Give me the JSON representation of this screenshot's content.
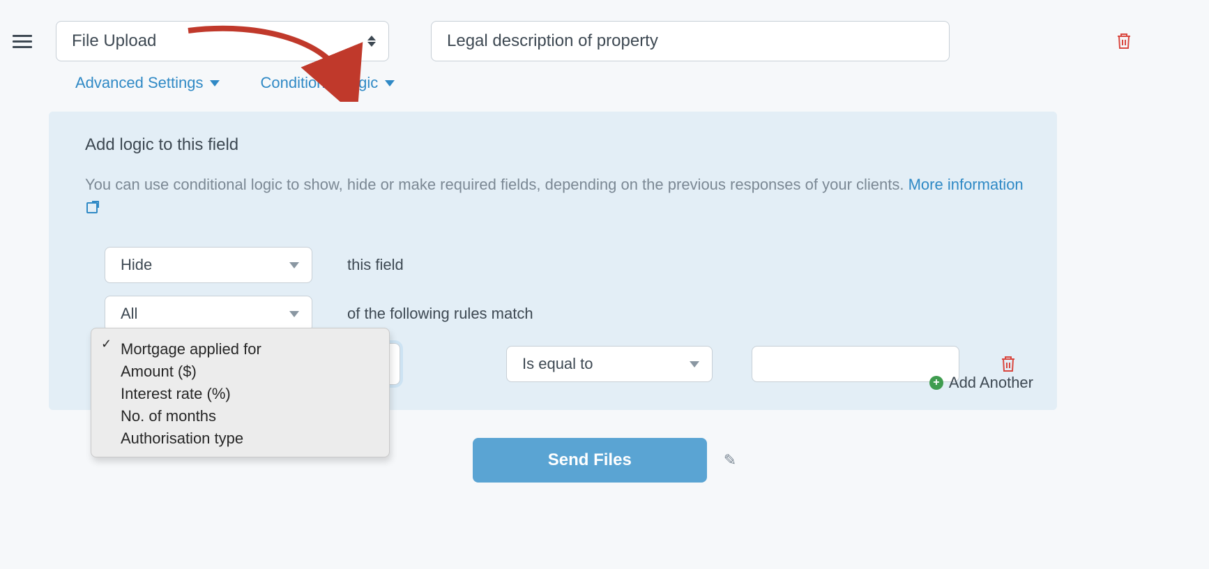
{
  "top": {
    "field_type": "File Upload",
    "field_label": "Legal description of property"
  },
  "tabs": {
    "advanced": "Advanced Settings",
    "conditional": "Conditional Logic"
  },
  "panel": {
    "heading": "Add logic to this field",
    "description": "You can use conditional logic to show, hide or make required fields, depending on the previous responses of your clients. ",
    "more_info_label": "More information",
    "action_select": "Hide",
    "action_suffix": "this field",
    "quantifier_select": "All",
    "quantifier_suffix": "of the following rules match",
    "rule_operator": "Is equal to",
    "rule_value": "",
    "add_another": "Add Another"
  },
  "field_options": [
    "",
    "Mortgage applied for",
    "Amount ($)",
    "Interest rate (%)",
    "No. of months",
    "Authorisation type"
  ],
  "submit_label": "Send Files",
  "colors": {
    "accent": "#2f89c5",
    "danger": "#d9463e",
    "success": "#3f9c4f",
    "button": "#5aa4d3"
  }
}
